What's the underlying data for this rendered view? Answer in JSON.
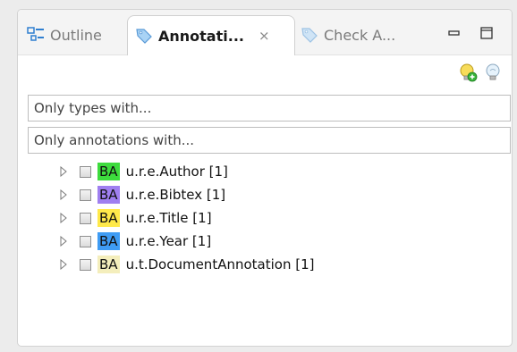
{
  "tabs": [
    {
      "label": "Outline",
      "active": false
    },
    {
      "label": "Annotati...",
      "active": true
    },
    {
      "label": "Check A...",
      "active": false
    }
  ],
  "filters": {
    "types_placeholder": "Only types with...",
    "annotations_placeholder": "Only annotations with..."
  },
  "tree": {
    "items": [
      {
        "badge": "BA",
        "label": "u.r.e.Author [1]",
        "color": "#3ddc3d"
      },
      {
        "badge": "BA",
        "label": "u.r.e.Bibtex [1]",
        "color": "#9f7ff0"
      },
      {
        "badge": "BA",
        "label": "u.r.e.Title [1]",
        "color": "#ffe94a"
      },
      {
        "badge": "BA",
        "label": "u.r.e.Year [1]",
        "color": "#3f9cf4"
      },
      {
        "badge": "BA",
        "label": "u.t.DocumentAnnotation [1]",
        "color": "#f4eebc"
      }
    ]
  },
  "icons": {
    "outline_tab": "outline-icon",
    "annotation_tab": "annotation-tag-icon",
    "check_tab": "check-tag-icon",
    "close": "close-icon",
    "minimize": "minimize-icon",
    "maximize": "maximize-icon",
    "add_bulb": "lightbulb-add-icon",
    "bulb": "lightbulb-icon"
  }
}
